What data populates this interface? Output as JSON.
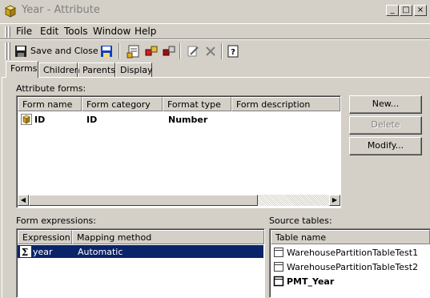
{
  "window": {
    "title": "Year - Attribute",
    "minimize_glyph": "_",
    "maximize_glyph": "□",
    "close_glyph": "×"
  },
  "menu": {
    "items": [
      "File",
      "Edit",
      "Tools",
      "Window",
      "Help"
    ]
  },
  "toolbar": {
    "save_close_label": "Save and Close"
  },
  "tabs": [
    {
      "label": "Forms",
      "active": true
    },
    {
      "label": "Children",
      "active": false
    },
    {
      "label": "Parents",
      "active": false
    },
    {
      "label": "Display",
      "active": false
    }
  ],
  "attribute_forms": {
    "label": "Attribute forms:",
    "columns": [
      "Form name",
      "Form category",
      "Format type",
      "Form description"
    ],
    "rows": [
      {
        "name": "ID",
        "category": "ID",
        "format": "Number",
        "description": ""
      }
    ]
  },
  "buttons": {
    "new": "New...",
    "delete": "Delete",
    "modify": "Modify..."
  },
  "form_expressions": {
    "label": "Form expressions:",
    "columns": [
      "Expression",
      "Mapping method"
    ],
    "rows": [
      {
        "expression": "year",
        "mapping": "Automatic",
        "selected": true
      }
    ]
  },
  "source_tables": {
    "label": "Source tables:",
    "column": "Table name",
    "rows": [
      {
        "name": "WarehousePartitionTableTest1",
        "bold": false
      },
      {
        "name": "WarehousePartitionTableTest2",
        "bold": false
      },
      {
        "name": "PMT_Year",
        "bold": true
      }
    ]
  },
  "colors": {
    "selection": "#0a246a",
    "face": "#d4d0c8",
    "disabled_text": "#808080"
  }
}
